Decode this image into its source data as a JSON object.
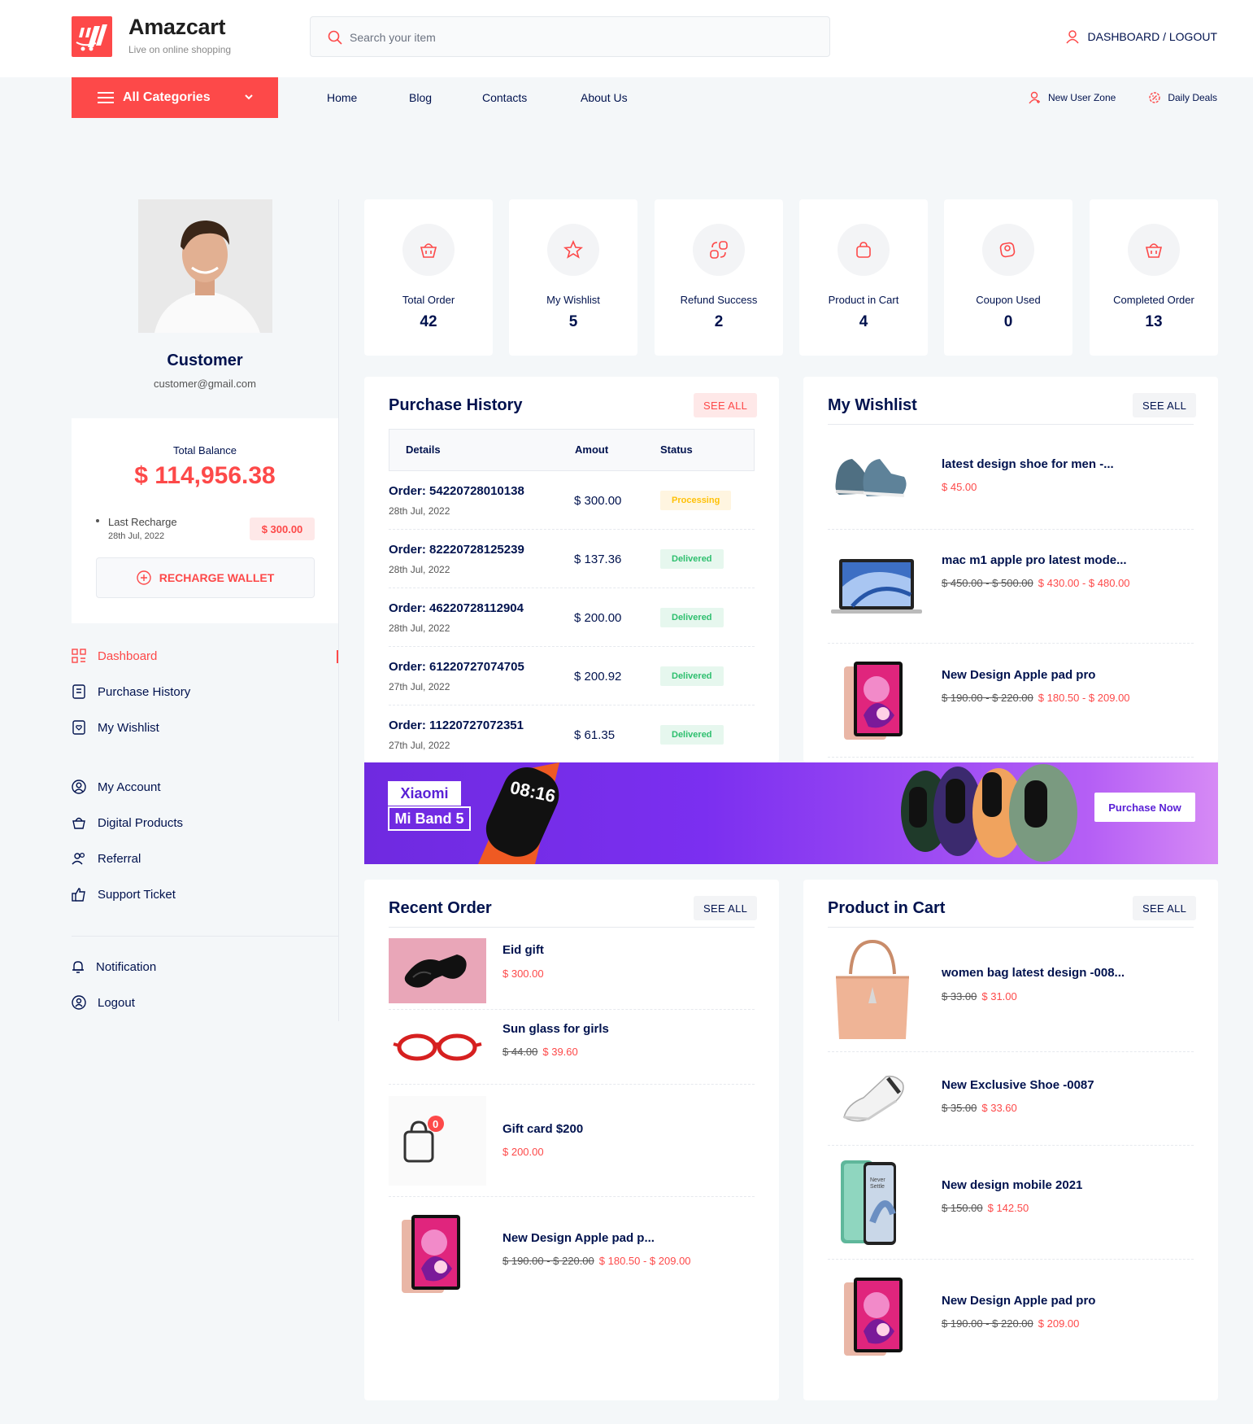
{
  "header": {
    "brand": "Amazcart",
    "tagline": "Live on online shopping",
    "search_placeholder": "Search your item",
    "account_link": "DASHBOARD / LOGOUT"
  },
  "nav": {
    "all_categories": "All Categories",
    "menu": [
      "Home",
      "Blog",
      "Contacts",
      "About Us"
    ],
    "new_user_zone": "New User Zone",
    "daily_deals": "Daily Deals"
  },
  "profile": {
    "name": "Customer",
    "email": "customer@gmail.com",
    "total_balance_label": "Total Balance",
    "total_balance": "$ 114,956.38",
    "last_recharge_label": "Last Recharge",
    "last_recharge_date": "28th Jul, 2022",
    "last_recharge_amount": "$ 300.00",
    "recharge_button": "RECHARGE WALLET"
  },
  "sidebar": {
    "items": [
      {
        "label": "Dashboard",
        "icon": "dashboard-icon",
        "active": true
      },
      {
        "label": "Purchase History",
        "icon": "receipt-icon"
      },
      {
        "label": "My Wishlist",
        "icon": "wishlist-icon"
      },
      {
        "label": "My Account",
        "icon": "user-circle-icon"
      },
      {
        "label": "Digital Products",
        "icon": "basket-icon"
      },
      {
        "label": "Referral",
        "icon": "users-icon"
      },
      {
        "label": "Support Ticket",
        "icon": "thumbs-up-icon"
      }
    ],
    "bottom": [
      {
        "label": "Notification",
        "icon": "bell-icon"
      },
      {
        "label": "Logout",
        "icon": "logout-icon"
      }
    ]
  },
  "stats": [
    {
      "label": "Total Order",
      "value": "42",
      "icon": "basket-icon"
    },
    {
      "label": "My Wishlist",
      "value": "5",
      "icon": "star-icon"
    },
    {
      "label": "Refund Success",
      "value": "2",
      "icon": "refund-icon"
    },
    {
      "label": "Product in Cart",
      "value": "4",
      "icon": "bag-icon"
    },
    {
      "label": "Coupon Used",
      "value": "0",
      "icon": "coupon-icon"
    },
    {
      "label": "Completed Order",
      "value": "13",
      "icon": "basket-icon"
    }
  ],
  "purchase_history": {
    "title": "Purchase History",
    "see_all": "SEE ALL",
    "columns": [
      "Details",
      "Amout",
      "Status"
    ],
    "rows": [
      {
        "order": "Order: 54220728010138",
        "date": "28th Jul, 2022",
        "amount": "$ 300.00",
        "status": "Processing"
      },
      {
        "order": "Order: 82220728125239",
        "date": "28th Jul, 2022",
        "amount": "$ 137.36",
        "status": "Delivered"
      },
      {
        "order": "Order: 46220728112904",
        "date": "28th Jul, 2022",
        "amount": "$ 200.00",
        "status": "Delivered"
      },
      {
        "order": "Order: 61220727074705",
        "date": "27th Jul, 2022",
        "amount": "$ 200.92",
        "status": "Delivered"
      },
      {
        "order": "Order: 11220727072351",
        "date": "27th Jul, 2022",
        "amount": "$ 61.35",
        "status": "Delivered"
      }
    ]
  },
  "wishlist": {
    "title": "My Wishlist",
    "see_all": "SEE ALL",
    "items": [
      {
        "name": "latest design shoe for men -...",
        "old_price": "",
        "price": "$ 45.00"
      },
      {
        "name": "mac m1 apple pro latest mode...",
        "old_price": "$ 450.00 - $ 500.00",
        "price": "$ 430.00 - $ 480.00"
      },
      {
        "name": "New Design Apple pad pro",
        "old_price": "$ 190.00 - $ 220.00",
        "price": "$ 180.50 - $ 209.00"
      }
    ]
  },
  "banner": {
    "line1": "Xiaomi",
    "line2": "Mi Band 5",
    "button": "Purchase Now",
    "watch_time": "08:16"
  },
  "recent_order": {
    "title": "Recent Order",
    "see_all": "SEE ALL",
    "items": [
      {
        "name": "Eid gift",
        "old_price": "",
        "price": "$ 300.00"
      },
      {
        "name": "Sun glass for girls",
        "old_price": "$ 44.00",
        "price": "$ 39.60"
      },
      {
        "name": "Gift card $200",
        "old_price": "",
        "price": "$ 200.00",
        "badge": "0"
      },
      {
        "name": "New Design Apple pad p...",
        "old_price": "$ 190.00 - $ 220.00",
        "price": "$ 180.50 - $ 209.00"
      }
    ]
  },
  "cart": {
    "title": "Product in Cart",
    "see_all": "SEE ALL",
    "items": [
      {
        "name": "women bag latest design -008...",
        "old_price": "$ 33.00",
        "price": "$ 31.00"
      },
      {
        "name": "New Exclusive Shoe -0087",
        "old_price": "$ 35.00",
        "price": "$ 33.60"
      },
      {
        "name": "New design mobile 2021",
        "old_price": "$ 150.00",
        "price": "$ 142.50"
      },
      {
        "name": "New Design Apple pad pro",
        "old_price": "$ 190.00 - $ 220.00",
        "price": "$ 209.00"
      }
    ]
  },
  "colors": {
    "accent": "#fd4949",
    "navy": "#00124e",
    "processing": "#ffc107",
    "delivered": "#2dbf6e"
  }
}
